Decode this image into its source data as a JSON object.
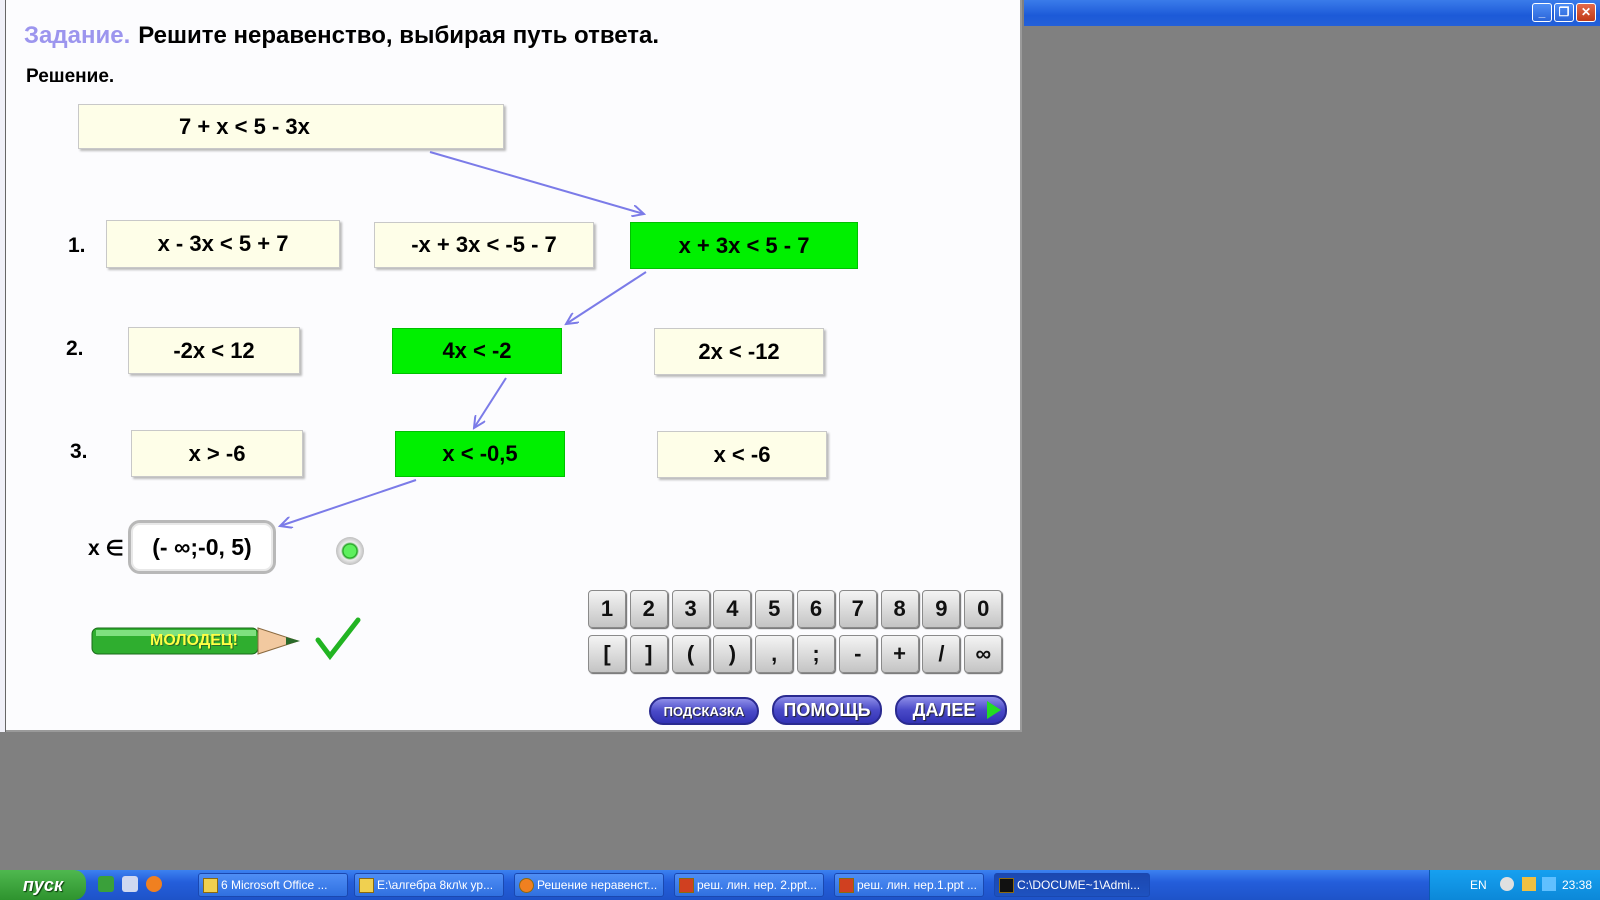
{
  "window": {
    "minimize": "_",
    "maximize": "❐",
    "close": "✕"
  },
  "task": {
    "label": "Задание.",
    "text": "Решите неравенство, выбирая путь ответа.",
    "solution_label": "Решение."
  },
  "start_inequality": "7 + x < 5 - 3x",
  "steps": [
    {
      "number": "1.",
      "options": [
        "x - 3x < 5 + 7",
        "-x + 3x < -5 - 7",
        "x + 3x < 5 - 7"
      ],
      "correct_index": 2
    },
    {
      "number": "2.",
      "options": [
        "-2x < 12",
        "4x < -2",
        "2x < -12"
      ],
      "correct_index": 1
    },
    {
      "number": "3.",
      "options": [
        "x > -6",
        "x < -0,5",
        "x < -6"
      ],
      "correct_index": 1
    }
  ],
  "answer": {
    "prefix": "x ∈",
    "value": "(- ∞;-0, 5)"
  },
  "praise": "МОЛОДЕЦ!",
  "keypad": {
    "row1": [
      "1",
      "2",
      "3",
      "4",
      "5",
      "6",
      "7",
      "8",
      "9",
      "0"
    ],
    "row2": [
      "[",
      "]",
      "(",
      ")",
      ",",
      ";",
      "-",
      "+",
      "/",
      "∞"
    ]
  },
  "buttons": {
    "hint": "ПОДСКАЗКА",
    "help": "ПОМОЩЬ",
    "next": "ДАЛЕЕ"
  },
  "taskbar": {
    "start": "пуск",
    "items": [
      "6 Microsoft Office ...",
      "E:\\алгебра 8кл\\к ур...",
      "Решение неравенст...",
      "реш. лин. нер. 2.ppt...",
      "реш. лин. нер.1.ppt ...",
      "C:\\DOCUME~1\\Admi..."
    ],
    "lang": "EN",
    "time": "23:38"
  },
  "colors": {
    "accent_title": "#9c95ee",
    "correct_box": "#00f000",
    "arrow": "#7b7be8"
  }
}
